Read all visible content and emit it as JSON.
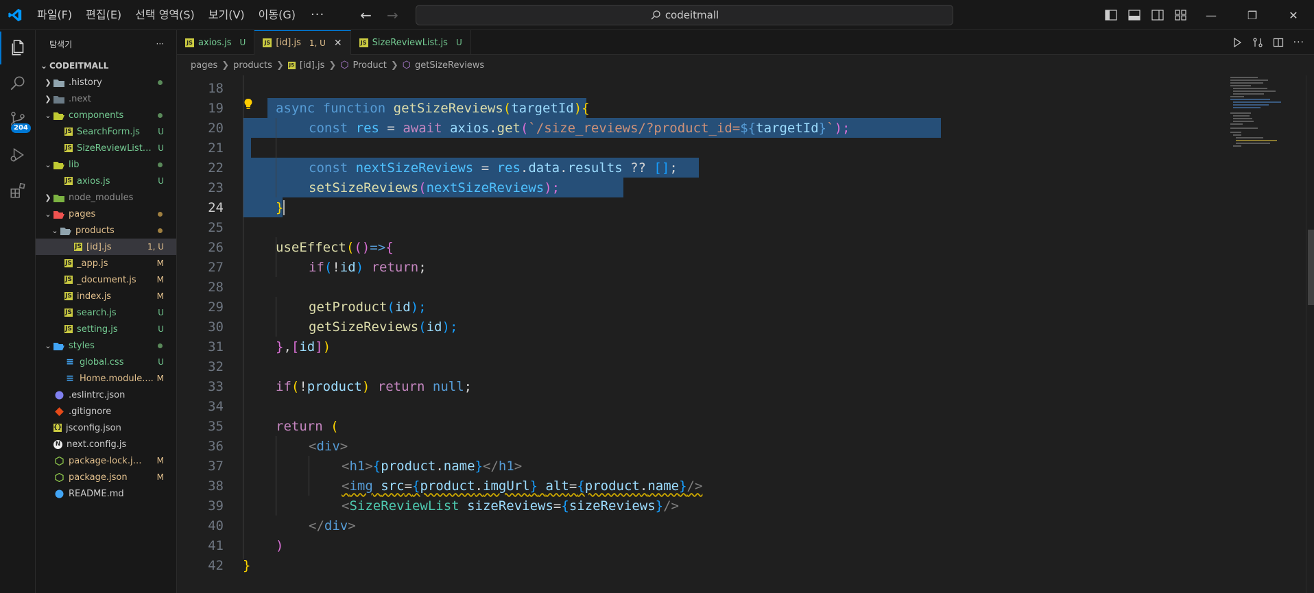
{
  "menu": [
    "파일(F)",
    "편집(E)",
    "선택 영역(S)",
    "보기(V)",
    "이동(G)"
  ],
  "menu_more": "···",
  "search_text": "codeitmall",
  "explorer": {
    "title": "탐색기",
    "more": "···",
    "root": "CODEITMALL",
    "items": [
      {
        "name": ".history",
        "status": ""
      },
      {
        "name": ".next",
        "status": ""
      },
      {
        "name": "components",
        "status": ""
      },
      {
        "name": "SearchForm.js",
        "status": "U"
      },
      {
        "name": "SizeReviewList.js",
        "status": "U"
      },
      {
        "name": "lib",
        "status": ""
      },
      {
        "name": "axios.js",
        "status": "U"
      },
      {
        "name": "node_modules",
        "status": ""
      },
      {
        "name": "pages",
        "status": ""
      },
      {
        "name": "products",
        "status": ""
      },
      {
        "name": "[id].js",
        "status": "1, U"
      },
      {
        "name": "_app.js",
        "status": "M"
      },
      {
        "name": "_document.js",
        "status": "M"
      },
      {
        "name": "index.js",
        "status": "M"
      },
      {
        "name": "search.js",
        "status": "U"
      },
      {
        "name": "setting.js",
        "status": "U"
      },
      {
        "name": "styles",
        "status": ""
      },
      {
        "name": "global.css",
        "status": "U"
      },
      {
        "name": "Home.module....",
        "status": "M"
      },
      {
        "name": ".eslintrc.json",
        "status": ""
      },
      {
        "name": ".gitignore",
        "status": ""
      },
      {
        "name": "jsconfig.json",
        "status": ""
      },
      {
        "name": "next.config.js",
        "status": ""
      },
      {
        "name": "package-lock.js...",
        "status": "M"
      },
      {
        "name": "package.json",
        "status": "M"
      },
      {
        "name": "README.md",
        "status": ""
      }
    ]
  },
  "source_control_badge": "204",
  "tabs": [
    {
      "name": "axios.js",
      "status": "U"
    },
    {
      "name": "[id].js",
      "status": "1, U"
    },
    {
      "name": "SizeReviewList.js",
      "status": "U"
    }
  ],
  "breadcrumb": [
    "pages",
    "products",
    "[id].js",
    "Product",
    "getSizeReviews"
  ],
  "line_numbers": [
    "18",
    "19",
    "20",
    "21",
    "22",
    "23",
    "24",
    "25",
    "26",
    "27",
    "28",
    "29",
    "30",
    "31",
    "32",
    "33",
    "34",
    "35",
    "36",
    "37",
    "38",
    "39",
    "40",
    "41",
    "42"
  ],
  "code": {
    "l19": {
      "async": "async",
      "function": "function",
      "name": "getSizeReviews",
      "p1": "(",
      "arg": "targetId",
      "p2": ")",
      "b": "{"
    },
    "l20": {
      "const": "const",
      "res": "res",
      "eq": " = ",
      "await": "await",
      "axios": "axios",
      "dot": ".",
      "get": "get",
      "p1": "(",
      "s1": "`/size_reviews/?product_id=",
      "d": "${",
      "tid": "targetId",
      "e": "}",
      "s2": "`",
      "p2": ");"
    },
    "l22": {
      "const": "const",
      "nsr": "nextSizeReviews",
      "eq": " = ",
      "res": "res",
      "d1": ".",
      "data": "data",
      "d2": ".",
      "results": "results",
      "op": " ?? ",
      "arr": "[]",
      "semi": ";"
    },
    "l23": {
      "fn": "setSizeReviews",
      "p1": "(",
      "arg": "nextSizeReviews",
      "p2": ");"
    },
    "l24": {
      "b": "}"
    },
    "l26": {
      "fn": "useEffect",
      "p1": "(",
      "p2": "()",
      "arrow": "=>",
      "b": "{"
    },
    "l27": {
      "if": "if",
      "p1": "(",
      "not": "!",
      "id": "id",
      "p2": ")",
      "ret": "return",
      "semi": ";"
    },
    "l29": {
      "fn": "getProduct",
      "p1": "(",
      "id": "id",
      "p2": ");"
    },
    "l30": {
      "fn": "getSizeReviews",
      "p1": "(",
      "id": "id",
      "p2": ");"
    },
    "l31": {
      "b": "}",
      "c": ",",
      "a1": "[",
      "id": "id",
      "a2": "]",
      "p": ")"
    },
    "l33": {
      "if": "if",
      "p1": "(",
      "not": "!",
      "prod": "product",
      "p2": ")",
      "ret": "return",
      "nul": "null",
      "semi": ";"
    },
    "l35": {
      "ret": "return",
      "p": "("
    },
    "l36": {
      "o": "<",
      "tag": "div",
      "c": ">"
    },
    "l37": {
      "o": "<",
      "tag": "h1",
      "c": ">",
      "b1": "{",
      "prod": "product",
      "dot": ".",
      "name": "name",
      "b2": "}",
      "o2": "</",
      "tag2": "h1",
      "c2": ">"
    },
    "l38": {
      "o": "<",
      "tag": "img",
      "src": "src",
      "eq": "=",
      "b1": "{",
      "prod": "product",
      "dot": ".",
      "url": "imgUrl",
      "b2": "}",
      "alt": "alt",
      "eq2": "=",
      "b3": "{",
      "prod2": "product",
      "dot2": ".",
      "name": "name",
      "b4": "}",
      "c": "/>"
    },
    "l39": {
      "o": "<",
      "tag": "SizeReviewList",
      "attr": "sizeReviews",
      "eq": "=",
      "b1": "{",
      "val": "sizeReviews",
      "b2": "}",
      "c": "/>"
    },
    "l40": {
      "o": "</",
      "tag": "div",
      "c": ">"
    },
    "l41": {
      "p": ")"
    },
    "l42": {
      "b": "}"
    }
  }
}
